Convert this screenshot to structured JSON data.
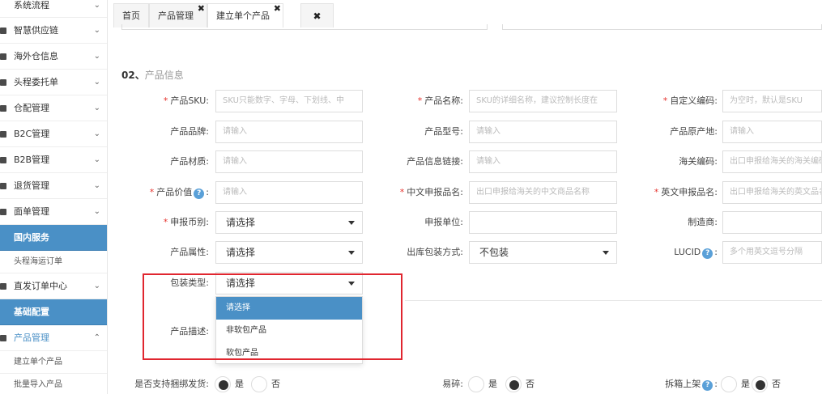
{
  "sidebar": {
    "items": [
      {
        "label": "系统流程"
      },
      {
        "label": "智慧供应链"
      },
      {
        "label": "海外仓信息"
      },
      {
        "label": "头程委托单"
      },
      {
        "label": "仓配管理"
      },
      {
        "label": "B2C管理"
      },
      {
        "label": "B2B管理"
      },
      {
        "label": "退货管理"
      },
      {
        "label": "面单管理"
      }
    ],
    "section1": "国内服务",
    "sub1": "头程海运订单",
    "item_direct": "直发订单中心",
    "section2": "基础配置",
    "product_mgmt": "产品管理",
    "sub_create": "建立单个产品",
    "sub_batch": "批量导入产品"
  },
  "tabs": {
    "home": "首页",
    "product_mgmt": "产品管理",
    "create_single": "建立单个产品",
    "close_mark": "✖"
  },
  "section": {
    "num": "02、",
    "title": "产品信息"
  },
  "form": {
    "sku_label": "产品SKU",
    "sku_ph": "SKU只能数字、字母、下划线、中",
    "name_label": "产品名称",
    "name_ph": "SKU的详细名称，建议控制长度在",
    "custom_code_label": "自定义编码",
    "custom_code_ph": "为空时，默认是SKU",
    "brand_label": "产品品牌",
    "brand_ph": "请输入",
    "model_label": "产品型号",
    "model_ph": "请输入",
    "origin_label": "产品原产地",
    "origin_ph": "请输入",
    "material_label": "产品材质",
    "material_ph": "请输入",
    "link_label": "产品信息链接",
    "link_ph": "请输入",
    "hs_label": "海关编码",
    "hs_ph": "出口申报给海关的海关编码",
    "value_label": "产品价值",
    "value_ph": "请输入",
    "cn_decl_label": "中文申报品名",
    "cn_decl_ph": "出口申报给海关的中文商品名称",
    "en_decl_label": "英文申报品名",
    "en_decl_ph": "出口申报给海关的英文品名",
    "currency_label": "申报币别",
    "currency_value": "请选择",
    "unit_label": "申报单位",
    "unit_value": "",
    "maker_label": "制造商",
    "maker_value": "",
    "attr_label": "产品属性",
    "attr_value": "请选择",
    "pack_out_label": "出库包装方式",
    "pack_out_value": "不包装",
    "lucid_label": "LUCID",
    "lucid_ph": "多个用英文逗号分隔",
    "pack_type_label": "包装类型",
    "pack_type_value": "请选择",
    "desc_label": "产品描述",
    "colon": ":",
    "bundle_label": "是否支持捆绑发货",
    "fragile_label": "易碎",
    "unpack_label": "拆箱上架",
    "yes": "是",
    "no": "否"
  },
  "dropdown": {
    "options": [
      "请选择",
      "非软包产品",
      "软包产品"
    ]
  },
  "colors": {
    "accent": "#4a90c6",
    "required": "#e5322d",
    "highlight_box": "#e0262f"
  }
}
